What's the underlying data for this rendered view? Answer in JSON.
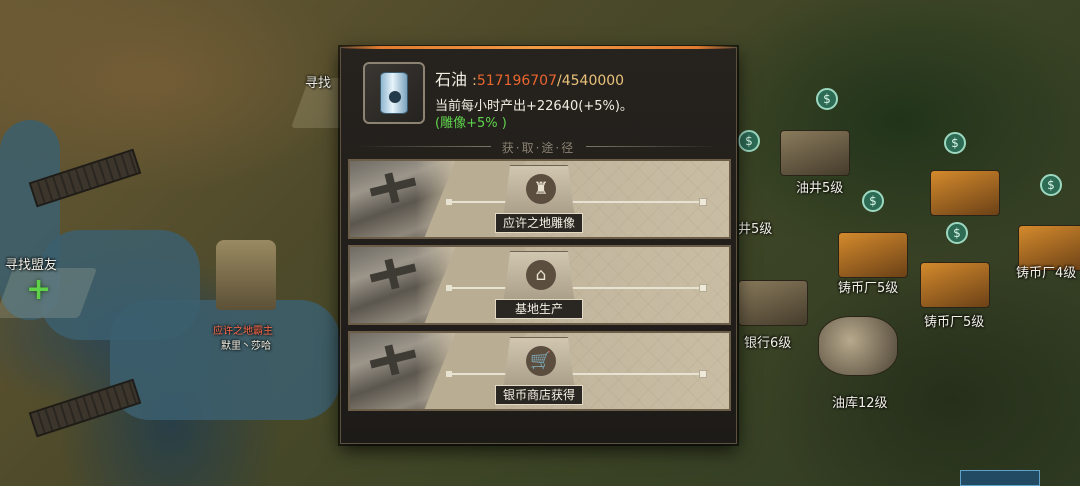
{
  "map": {
    "find_ally_label_left": "寻找盟友",
    "find_ally_label_top": "寻找",
    "statue_title": "应许之地霸主",
    "statue_owner": "默里丶莎哈",
    "buildings": [
      "油井5级",
      "铸币厂4级",
      "铸币厂5级",
      "铸币厂5级",
      "银行6级",
      "油库12级",
      "井5级"
    ],
    "pin_icon": "coin-pin-icon"
  },
  "resource": {
    "icon": "oil-barrel-icon",
    "name": "石油",
    "colon": ":",
    "current": "517196707",
    "separator": "/",
    "capacity": "4540000",
    "production_text": "当前每小时产出+22640(+5%)。",
    "bonus_text": "(雕像+5% )"
  },
  "sources_header": "获·取·途·径",
  "sources": [
    {
      "label": "应许之地雕像",
      "icon": "statue-icon",
      "symbol": "♜"
    },
    {
      "label": "基地生产",
      "icon": "base-building-icon",
      "symbol": "⌂"
    },
    {
      "label": "银币商店获得",
      "icon": "shopping-cart-icon",
      "symbol": "🛒"
    }
  ],
  "colors": {
    "current_value": "#e8662e",
    "capacity_value": "#e9c27a",
    "bonus": "#5fd34c",
    "panel_accent": "#f29a45"
  }
}
